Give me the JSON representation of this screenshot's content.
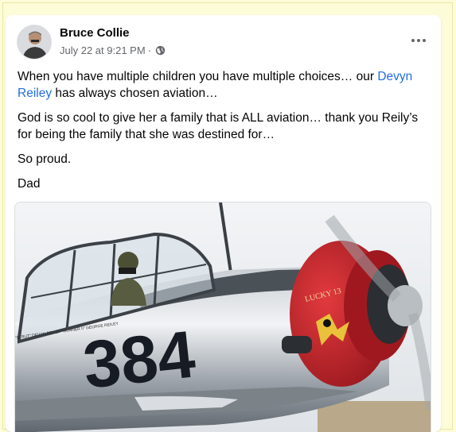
{
  "post": {
    "author": "Bruce Collie",
    "timestamp": "July 22 at 9:21 PM",
    "separator": "·",
    "privacy_icon": "globe-icon",
    "more_icon": "more-options-icon",
    "text": {
      "p1_before": "When you have multiple children you have multiple choices… our ",
      "mention": "Devyn Reiley",
      "p1_after": " has always chosen aviation…",
      "p2": "God is so cool to give her a family that is ALL aviation… thank you Reily’s  for being the family that she was destined for…",
      "p3": "So proud.",
      "p4": "Dad"
    },
    "image": {
      "plane_number": "384",
      "nose_art": "LUCKY 13",
      "small_text": "\"STRUT\" DEVYN REILEY\n\"GUNNER II\" GEORGE REILEY"
    }
  },
  "colors": {
    "background": "#fdfcd8",
    "card": "#ffffff",
    "link": "#216fdb",
    "muted": "#65676b",
    "cowl_red": "#c8202a"
  }
}
